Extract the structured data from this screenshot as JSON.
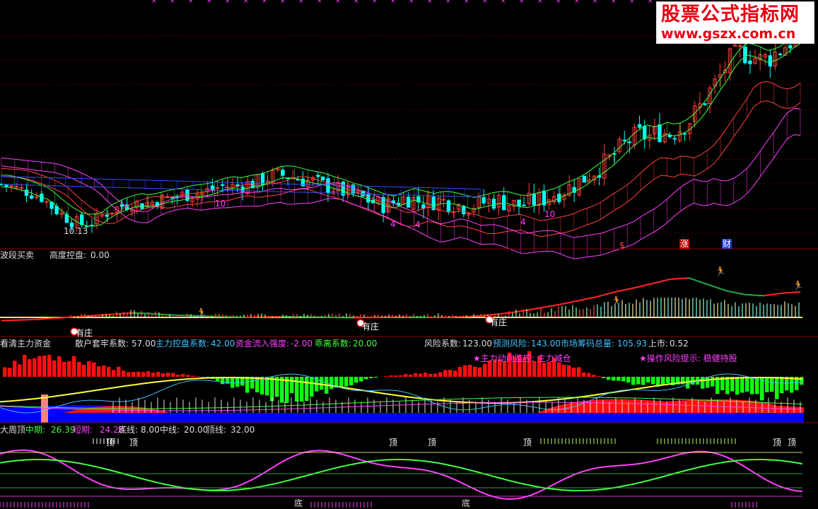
{
  "colors": {
    "background": "#000000",
    "up": "#ff3c3c",
    "down": "#00ffff",
    "divider": "#8b0000",
    "magenta": "#ff40ff",
    "green": "#00ff00",
    "yellow": "#ffff40",
    "blue": "#0000ff"
  },
  "watermark": {
    "line1": "股票公式指标网",
    "line2": "www.gszx.com.cn"
  },
  "panel1": {
    "price_low_label": "10.13",
    "buy_numbers": [
      "10",
      "4",
      "4",
      "4",
      "10"
    ],
    "signals": [
      "$",
      "涨",
      "财"
    ]
  },
  "panel2": {
    "title": "波段买卖",
    "metric_label": "高度控盘:",
    "metric_value": "0.00",
    "tag": "有庄"
  },
  "panel3": {
    "title": "看清主力资金",
    "metrics": [
      {
        "label": "散户套牢系数:",
        "value": "57.00"
      },
      {
        "label": "主力控盘系数:",
        "value": "42.00"
      },
      {
        "label": "资金流入强度:",
        "value": "-2.00"
      },
      {
        "label": "乖离系数:",
        "value": "20.00"
      },
      {
        "label": "风险系数:",
        "value": "123.00"
      },
      {
        "label": "预测风险:",
        "value": "143.00"
      },
      {
        "label": "市场筹码总量:",
        "value": "105.93"
      },
      {
        "label": "上市:",
        "value": "0.52"
      }
    ],
    "hint1": "★主力动向监控: 主力减仓",
    "hint2": "★操作风险提示: 稳健持股"
  },
  "panel4": {
    "title": "大周顶",
    "metrics": [
      {
        "label": "中期:",
        "value": "26.39"
      },
      {
        "label": "短期:",
        "value": "24.28"
      },
      {
        "label": "底线:",
        "value": "8.00"
      },
      {
        "label": "中线:",
        "value": "20.00"
      },
      {
        "label": "顶线:",
        "value": "32.00"
      }
    ],
    "top_mark": "顶",
    "bottom_mark": "底"
  },
  "chart_data": [
    {
      "type": "candlestick",
      "title": "",
      "price_low_marker": 10.13,
      "close_path": [
        13.2,
        13.0,
        12.8,
        12.5,
        12.2,
        11.5,
        10.9,
        10.4,
        10.2,
        10.3,
        10.9,
        11.3,
        11.6,
        11.8,
        11.7,
        11.9,
        12.1,
        12.2,
        12.4,
        12.5,
        12.6,
        12.9,
        13.1,
        13.0,
        13.2,
        13.3,
        13.6,
        13.9,
        13.9,
        13.7,
        13.5,
        13.4,
        13.1,
        12.9,
        12.6,
        12.4,
        12.1,
        11.8,
        11.6,
        11.9,
        12.2,
        12.0,
        11.8,
        12.0,
        11.9,
        11.7,
        11.5,
        11.7,
        11.9,
        12.0,
        11.8,
        11.6,
        11.8,
        12.0,
        12.2,
        12.6,
        12.9,
        13.3,
        13.9,
        14.4,
        15.0,
        15.8,
        16.5,
        17.0,
        16.8,
        17.2,
        17.0,
        17.4,
        18.0,
        19.0,
        20.2,
        21.3,
        22.6,
        23.2,
        23.0,
        22.6,
        22.8,
        23.4,
        24.0,
        24.2
      ]
    },
    {
      "type": "bar",
      "title": "波段买卖",
      "metric": {
        "高度控盘": 0.0
      },
      "band_line_path": [
        -0.5,
        -0.4,
        -0.3,
        -0.1,
        0.1,
        0.3,
        0.5,
        0.7,
        0.6,
        0.4,
        0.3,
        0.2,
        0.1,
        0.0,
        0.05,
        0.1,
        0.08,
        0.05,
        0.0,
        -0.05,
        0.0,
        0.05,
        0.05,
        0.0,
        0.02,
        0.1,
        0.3,
        0.6,
        1.0,
        1.5,
        2.0,
        2.6,
        3.2,
        4.0,
        4.6,
        5.3,
        6.0,
        6.2,
        5.2,
        4.2,
        3.6,
        3.4,
        3.8,
        4.0
      ]
    },
    {
      "type": "bar",
      "title": "看清主力资金",
      "series": [
        {
          "name": "散户套牢系数",
          "values": [
            57
          ]
        },
        {
          "name": "主力控盘系数",
          "values": [
            42
          ]
        },
        {
          "name": "资金流入强度",
          "values": [
            -2
          ]
        },
        {
          "name": "乖离系数",
          "values": [
            20
          ]
        },
        {
          "name": "风险系数",
          "values": [
            123
          ]
        },
        {
          "name": "预测风险",
          "values": [
            143
          ]
        },
        {
          "name": "市场筹码总量",
          "values": [
            105.93
          ]
        },
        {
          "name": "上市",
          "values": [
            0.52
          ]
        }
      ]
    },
    {
      "type": "line",
      "title": "大周顶",
      "series": [
        {
          "name": "中期",
          "values": [
            26.39
          ]
        },
        {
          "name": "短期",
          "values": [
            24.28
          ]
        },
        {
          "name": "底线",
          "values": [
            8.0
          ]
        },
        {
          "name": "中线",
          "values": [
            20.0
          ]
        },
        {
          "name": "顶线",
          "values": [
            32.0
          ]
        }
      ]
    }
  ]
}
